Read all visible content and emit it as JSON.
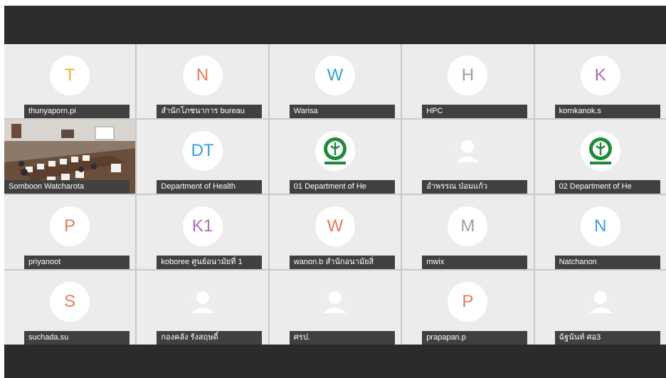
{
  "participants": [
    {
      "name": "thunyaporn.pi",
      "initials": "T",
      "color": "#e6b52e",
      "type": "initials"
    },
    {
      "name": "สำนักโภชนาการ bureau",
      "initials": "N",
      "color": "#e8795a",
      "type": "initials"
    },
    {
      "name": "Warisa",
      "initials": "W",
      "color": "#3a9fd8",
      "type": "initials"
    },
    {
      "name": "HPC",
      "initials": "H",
      "color": "#9aa0a6",
      "type": "initials"
    },
    {
      "name": "kornkanok.s",
      "initials": "K",
      "color": "#b06cb8",
      "type": "initials"
    },
    {
      "name": "Somboon Watcharota",
      "type": "video"
    },
    {
      "name": "Department of Health",
      "initials": "DT",
      "color": "#3a9fd8",
      "type": "initials"
    },
    {
      "name": "01 Department of He",
      "type": "logo"
    },
    {
      "name": "อำพรรณ ป่อมแก้ว",
      "type": "photo"
    },
    {
      "name": "02 Department of He",
      "type": "logo"
    },
    {
      "name": "priyanoot",
      "initials": "P",
      "color": "#e8795a",
      "type": "initials"
    },
    {
      "name": "koboree ศูนย์อนามัยที่ 1",
      "initials": "K1",
      "color": "#b06cb8",
      "type": "initials"
    },
    {
      "name": "wanon.b สำนักอนามัยสิ่",
      "initials": "W",
      "color": "#e8795a",
      "type": "initials"
    },
    {
      "name": "mwix",
      "initials": "M",
      "color": "#9aa0a6",
      "type": "initials"
    },
    {
      "name": "Natchanon",
      "initials": "N",
      "color": "#3a9fd8",
      "type": "initials"
    },
    {
      "name": "suchada.su",
      "initials": "S",
      "color": "#e8795a",
      "type": "initials"
    },
    {
      "name": "กองคลัง รังสฤษดิ์",
      "type": "photo"
    },
    {
      "name": "ศรป.",
      "type": "photo"
    },
    {
      "name": "prapapan.p",
      "initials": "P",
      "color": "#e8795a",
      "type": "initials"
    },
    {
      "name": "ฉัฐนันท์ ศอ3",
      "type": "photo"
    }
  ]
}
